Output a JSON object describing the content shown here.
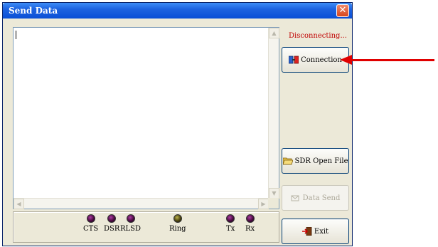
{
  "window": {
    "title": "Send Data",
    "close_symbol": "✕"
  },
  "status": {
    "text": "Disconnecting...",
    "color": "#c00000"
  },
  "buttons": {
    "connection": {
      "label": "Connection",
      "icon": "connection-icon",
      "enabled": true
    },
    "sdr_open_file": {
      "label": "SDR Open File",
      "icon": "folder-open-icon",
      "enabled": true
    },
    "data_send": {
      "label": "Data Send",
      "icon": "send-icon",
      "enabled": false
    },
    "exit": {
      "label": "Exit",
      "icon": "exit-door-icon",
      "enabled": true
    }
  },
  "textarea": {
    "value": ""
  },
  "indicators": [
    {
      "label": "CTS",
      "led_color": "#4a0a40"
    },
    {
      "label": "DSR",
      "led_color": "#4a0a40"
    },
    {
      "label": "RLSD",
      "led_color": "#4a0a40"
    },
    {
      "label": "Ring",
      "led_color": "#4a4210"
    },
    {
      "label": "Tx",
      "led_color": "#4a0a40"
    },
    {
      "label": "Rx",
      "led_color": "#4a0a40"
    }
  ],
  "annotation": {
    "arrow_color": "#e00000",
    "points_to": "connection-button"
  }
}
